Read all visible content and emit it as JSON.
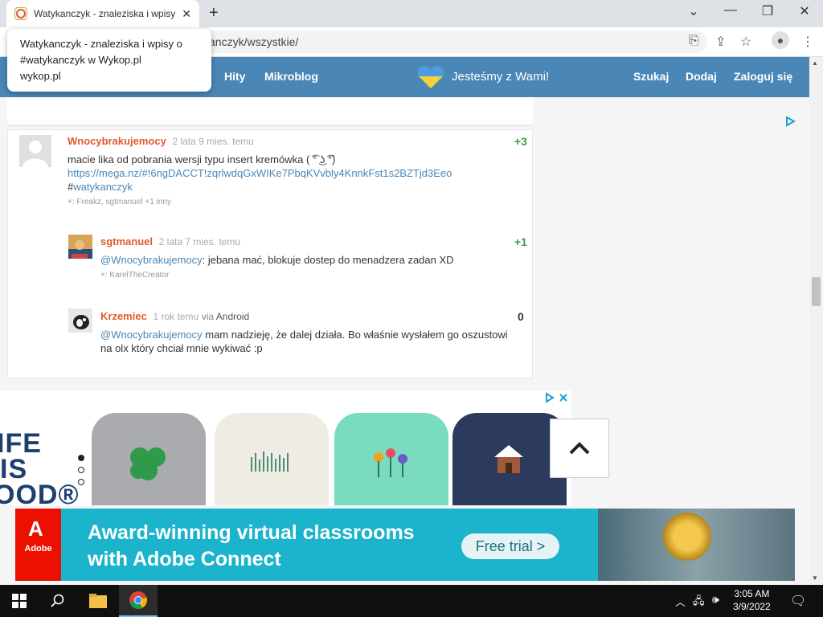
{
  "browser": {
    "tab_title": "Watykanczyk - znaleziska i wpisy",
    "url_visible": "anczyk/wszystkie/",
    "tooltip": {
      "title_line1": "Watykanczyk - znaleziska i wpisy o",
      "title_line2": "#watykanczyk w Wykop.pl",
      "domain": "wykop.pl"
    }
  },
  "site": {
    "nav": {
      "hity": "Hity",
      "mikroblog": "Mikroblog",
      "search": "Szukaj",
      "add": "Dodaj",
      "login": "Zaloguj się"
    },
    "slogan": "Jesteśmy z Wami!",
    "colors": {
      "header": "#4a87b7",
      "username": "#e05a2c",
      "vote_positive": "#3b9a3b"
    }
  },
  "entries": [
    {
      "username": "Wnocybrakujemocy",
      "time": "2 lata 9 mies. temu",
      "vote": "+3",
      "text": "macie lika od pobrania wersji typu insert kremówka ( ͡° ͜ʖ ͡°)",
      "link": "https://mega.nz/#!6ngDACCT!zqrlwdqGxWIKe7PbqKVvbly4KnnkFst1s2BZTjd3Eeo",
      "tag_prefix": "#",
      "tag": "watykanczyk",
      "plus_label": "+: Freakz, sgtmanuel +1 inny"
    },
    {
      "username": "sgtmanuel",
      "time": "2 lata 7 mies. temu",
      "vote": "+1",
      "mention": "@Wnocybrakujemocy",
      "text": ": jebana mać, blokuje dostep do menadzera zadan XD",
      "plus_label": "+: KarelTheCreator"
    },
    {
      "username": "Krzemiec",
      "time": "1 rok temu",
      "via_label": "via",
      "via": "Android",
      "vote": "0",
      "mention": "@Wnocybrakujemocy",
      "text_line1": " mam nadzieję, że dalej działa. Bo właśnie wysłałem go oszustowi",
      "text_line2": "na olx który chciał mnie wykiwać :p"
    }
  ],
  "ad_carousel": {
    "brand_lines": [
      "IFE",
      "IS",
      "OOD®"
    ]
  },
  "banner": {
    "brand": "Adobe",
    "headline_line1": "Award-winning virtual classrooms",
    "headline_line2": "with Adobe Connect",
    "cta": "Free trial >"
  },
  "taskbar": {
    "time": "3:05 AM",
    "date": "3/9/2022"
  }
}
